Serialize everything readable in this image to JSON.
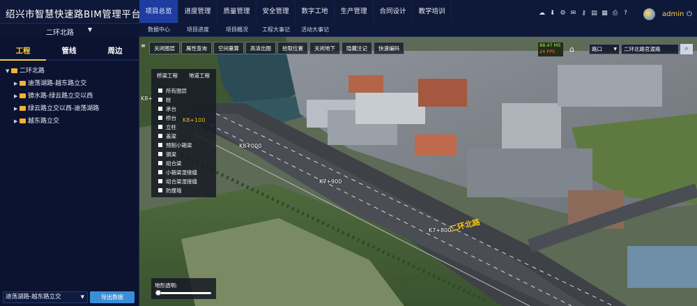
{
  "app": {
    "title": "绍兴市智慧快速路BIM管理平台"
  },
  "road_select": {
    "value": "二环北路"
  },
  "nav": {
    "main": [
      "项目总览",
      "进度管理",
      "质量管理",
      "安全管理",
      "数字工地",
      "生产管理",
      "合同设计",
      "教学培训"
    ],
    "active_index": 0,
    "sub": [
      "数据中心",
      "项目进度",
      "项目概况",
      "工程大事记",
      "活动大事记"
    ]
  },
  "header_icons": [
    "cloud-icon",
    "cloud-download-icon",
    "gear-icon",
    "mail-icon",
    "key-icon",
    "doc-icon",
    "calendar-icon",
    "print-icon",
    "help-icon"
  ],
  "user": {
    "name": "admin"
  },
  "sidebar": {
    "tabs": [
      "工程",
      "管线",
      "周边"
    ],
    "active_tab": 0,
    "tree": {
      "root": "二环北路",
      "children": [
        "迪荡湖路-越东路立交",
        "镜水路-绿云路立交以西",
        "绿云路立交以西-迪荡湖路",
        "越东路立交"
      ]
    },
    "footer": {
      "segment_select": "迪荡湖路-越东路立交",
      "export_label": "导出数据"
    }
  },
  "map_toolbar": [
    "关闭图层",
    "属性查询",
    "空间量算",
    "高清出图",
    "拾取位置",
    "关闭地下",
    "隐藏注记",
    "快速编码"
  ],
  "fps": {
    "ms": "88.47 MS",
    "fps": "24 FPS"
  },
  "map_search": {
    "select_value": "路口",
    "input_value": "二环北路官渡路"
  },
  "layer_panel": {
    "tabs": [
      "桥梁工程",
      "地道工程"
    ],
    "items": [
      "所有图层",
      "桩",
      "承台",
      "桥台",
      "立柱",
      "盖梁",
      "预制小箱梁",
      "钢梁",
      "组合梁",
      "小箱梁湿接缝",
      "组合梁湿接缝",
      "防撞墙"
    ]
  },
  "opacity": {
    "label": "地形透明:",
    "value": 0.05
  },
  "map_labels": {
    "stations": [
      "K8+000",
      "K7+900",
      "K7+800",
      "K8+100",
      "K8+"
    ],
    "road_name": "二环北路"
  },
  "colors": {
    "accent": "#1f3da0",
    "highlight": "#ffcc33",
    "button": "#3a8ed8"
  }
}
